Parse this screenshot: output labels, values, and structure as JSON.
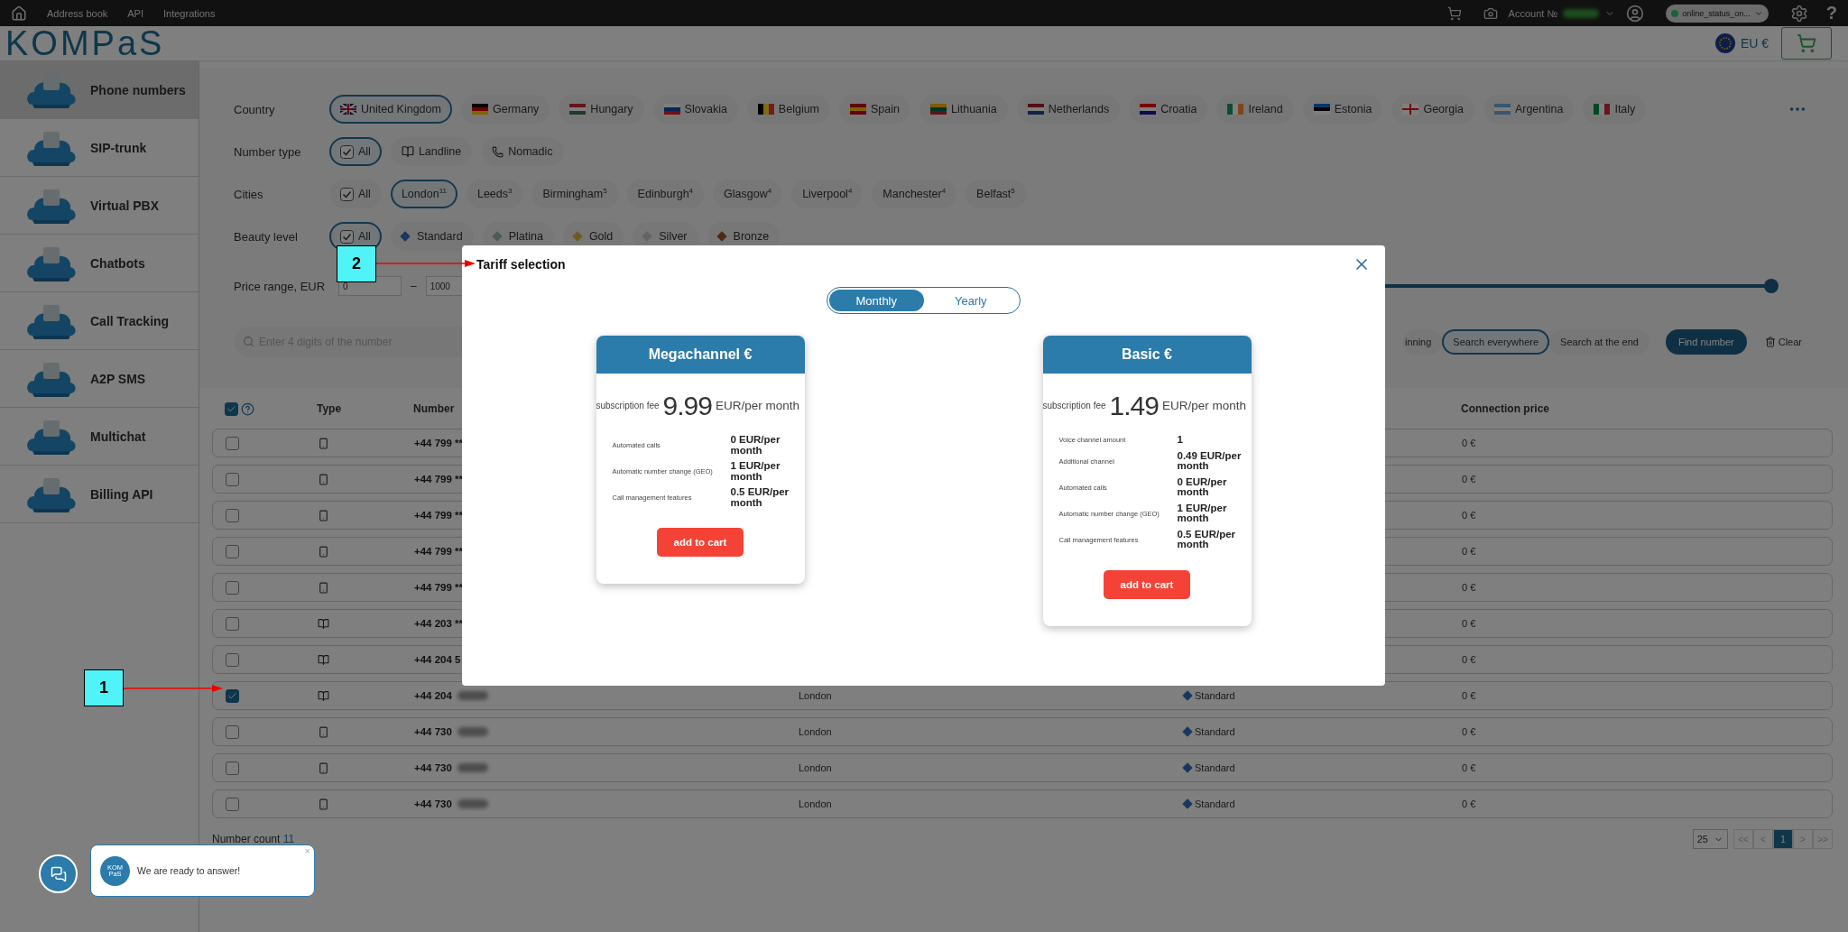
{
  "top_bar": {
    "links": [
      "Address book",
      "API",
      "Integrations"
    ],
    "account": {
      "label": "Account №",
      "redacted": true
    },
    "status": "online_status_on...",
    "help": "?"
  },
  "header": {
    "logo": "KOMPaS",
    "currency": "EU €"
  },
  "sidebar": {
    "items": [
      {
        "label": "Phone numbers",
        "selected": true
      },
      {
        "label": "SIP-trunk",
        "selected": false
      },
      {
        "label": "Virtual PBX",
        "selected": false
      },
      {
        "label": "Chatbots",
        "selected": false
      },
      {
        "label": "Call Tracking",
        "selected": false
      },
      {
        "label": "A2P SMS",
        "selected": false
      },
      {
        "label": "Multichat",
        "selected": false
      },
      {
        "label": "Billing API",
        "selected": false
      }
    ]
  },
  "filters": {
    "country": {
      "label": "Country",
      "options": [
        {
          "label": "United Kingdom",
          "selected": true
        },
        {
          "label": "Germany",
          "selected": false
        },
        {
          "label": "Hungary",
          "selected": false
        },
        {
          "label": "Slovakia",
          "selected": false
        },
        {
          "label": "Belgium",
          "selected": false
        },
        {
          "label": "Spain",
          "selected": false
        },
        {
          "label": "Lithuania",
          "selected": false
        },
        {
          "label": "Netherlands",
          "selected": false
        },
        {
          "label": "Croatia",
          "selected": false
        },
        {
          "label": "Ireland",
          "selected": false
        },
        {
          "label": "Estonia",
          "selected": false
        },
        {
          "label": "Georgia",
          "selected": false
        },
        {
          "label": "Argentina",
          "selected": false
        },
        {
          "label": "Italy",
          "selected": false
        }
      ]
    },
    "number_type": {
      "label": "Number type",
      "options": [
        {
          "label": "All",
          "kind": "check",
          "selected": true
        },
        {
          "label": "Landline",
          "kind": "landline",
          "selected": false
        },
        {
          "label": "Nomadic",
          "kind": "nomadic",
          "selected": false
        }
      ]
    },
    "cities": {
      "label": "Cities",
      "options": [
        {
          "label": "All",
          "kind": "check",
          "selected": false
        },
        {
          "label": "London$^{11}$",
          "kind": "text",
          "selected": true
        },
        {
          "label": "Leeds$^{3}$",
          "kind": "text",
          "selected": false
        },
        {
          "label": "Birmingham$^{5}$",
          "kind": "text",
          "selected": false
        },
        {
          "label": "Edinburgh$^{4}$",
          "kind": "text",
          "selected": false
        },
        {
          "label": "Glasgow$^{4}$",
          "kind": "text",
          "selected": false
        },
        {
          "label": "Liverpool$^{4}$",
          "kind": "text",
          "selected": false
        },
        {
          "label": "Manchester$^{4}$",
          "kind": "text",
          "selected": false
        },
        {
          "label": "Belfast$^{5}$",
          "kind": "text",
          "selected": false
        }
      ]
    },
    "beauty_level": {
      "label": "Beauty level",
      "options": [
        {
          "label": "All",
          "kind": "check",
          "selected": true
        },
        {
          "label": "Standard",
          "kind": "sapphire",
          "selected": false
        },
        {
          "label": "Platina",
          "kind": "platinum",
          "selected": false
        },
        {
          "label": "Gold",
          "kind": "gold",
          "selected": false
        },
        {
          "label": "Silver",
          "kind": "silver",
          "selected": false
        },
        {
          "label": "Bronze",
          "kind": "bronze",
          "selected": false
        }
      ]
    },
    "price_range": {
      "label": "Price range, EUR",
      "min": "0",
      "separator": "–",
      "max": "1000",
      "level": 1
    },
    "search": {
      "placeholder": "Enter 4 digits of the number",
      "modes": [
        {
          "label": "inning",
          "selected": false
        },
        {
          "label": "Search everywhere",
          "selected": true
        },
        {
          "label": "Search at the end",
          "selected": false
        }
      ],
      "find": "Find number",
      "clear": "Clear"
    }
  },
  "table": {
    "select_all_checked": true,
    "columns": [
      "Type",
      "Number",
      "Connection price"
    ],
    "rows": [
      {
        "checked": false,
        "kind": "mobile",
        "number": "+44 799 **",
        "price": "0 €"
      },
      {
        "checked": false,
        "kind": "mobile",
        "number": "+44 799 **",
        "price": "0 €"
      },
      {
        "checked": false,
        "kind": "mobile",
        "number": "+44 799 **",
        "price": "0 €"
      },
      {
        "checked": false,
        "kind": "mobile",
        "number": "+44 799 **",
        "price": "0 €"
      },
      {
        "checked": false,
        "kind": "mobile",
        "number": "+44 799 **",
        "price": "0 €"
      },
      {
        "checked": false,
        "kind": "landline",
        "number": "+44 203 **",
        "price": "0 €"
      },
      {
        "checked": false,
        "kind": "landline",
        "number": "+44 204 5",
        "price": "0 €"
      },
      {
        "checked": true,
        "kind": "landline",
        "number": "+44 204",
        "redacted": true,
        "city": "London",
        "beauty": "Standard",
        "price": "0 €"
      },
      {
        "checked": false,
        "kind": "mobile",
        "number": "+44 730",
        "redacted": true,
        "city": "London",
        "beauty": "Standard",
        "price": "0 €"
      },
      {
        "checked": false,
        "kind": "mobile",
        "number": "+44 730",
        "redacted": true,
        "city": "London",
        "beauty": "Standard",
        "price": "0 €"
      },
      {
        "checked": false,
        "kind": "mobile",
        "number": "+44 730",
        "redacted": true,
        "city": "London",
        "beauty": "Standard",
        "price": "0 €"
      }
    ]
  },
  "footer": {
    "count_label": "Number count",
    "count": "11",
    "page_size": "25",
    "pages": [
      {
        "label": "<<",
        "selected": false
      },
      {
        "label": "<",
        "selected": false
      },
      {
        "label": "1",
        "selected": true
      },
      {
        "label": ">",
        "selected": false
      },
      {
        "label": ">>",
        "selected": false
      }
    ]
  },
  "modal": {
    "title": "Tariff selection",
    "periods": [
      {
        "label": "Monthly",
        "selected": true
      },
      {
        "label": "Yearly",
        "selected": false
      }
    ],
    "plans": [
      {
        "title": "Megachannel €",
        "fee_label": "subscription fee",
        "price": "9.99",
        "unit": "EUR/per month",
        "features": [
          {
            "name": "Automated calls",
            "value": "0 EUR/per month"
          },
          {
            "name": "Automatic number change (GEO)",
            "value": "1 EUR/per month"
          },
          {
            "name": "Call management features",
            "value": "0.5 EUR/per month"
          }
        ],
        "button": "add to cart"
      },
      {
        "title": "Basic €",
        "fee_label": "subscription fee",
        "price": "1.49",
        "unit": "EUR/per month",
        "features": [
          {
            "name": "Voice channel amount",
            "value": "1"
          },
          {
            "name": "Additional channel",
            "value": "0.49 EUR/per month"
          },
          {
            "name": "Automated calls",
            "value": "0 EUR/per month"
          },
          {
            "name": "Automatic number change (GEO)",
            "value": "1 EUR/per month"
          },
          {
            "name": "Call management features",
            "value": "0.5 EUR/per month"
          }
        ],
        "button": "add to cart"
      }
    ]
  },
  "chat": {
    "logo": "KOM PaS",
    "message": "We are ready to answer!",
    "close": "×"
  },
  "callouts": [
    {
      "label": "1"
    },
    {
      "label": "2"
    }
  ]
}
